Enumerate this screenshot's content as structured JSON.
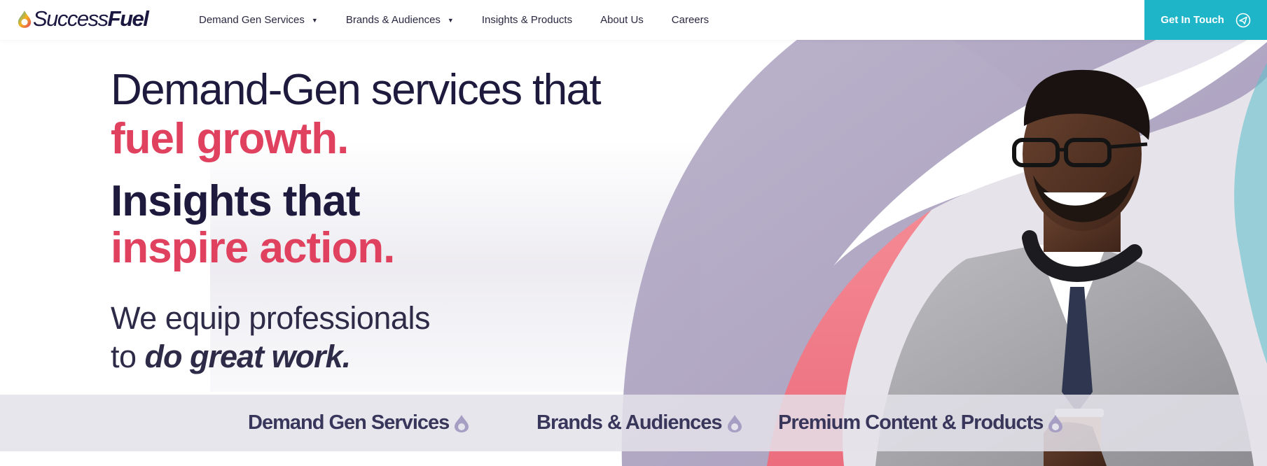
{
  "brand": {
    "name_part1": "Success",
    "name_part2": "Fuel"
  },
  "nav": {
    "items": [
      {
        "label": "Demand Gen Services",
        "has_dropdown": true
      },
      {
        "label": "Brands & Audiences",
        "has_dropdown": true
      },
      {
        "label": "Insights & Products",
        "has_dropdown": false
      },
      {
        "label": "About Us",
        "has_dropdown": false
      },
      {
        "label": "Careers",
        "has_dropdown": false
      }
    ],
    "cta_label": "Get In Touch",
    "cta_icon": "paper-plane-icon"
  },
  "hero": {
    "line1": "Demand-Gen services that",
    "line1_accent": "fuel growth.",
    "line2": "Insights that",
    "line2_accent": "inspire action.",
    "sub_line1": "We equip professionals",
    "sub_line2_prefix": "to ",
    "sub_line2_emphasis": "do great work",
    "sub_line2_suffix": "."
  },
  "bar": {
    "links": [
      {
        "label": "Demand Gen Services",
        "icon": "fuel-drop-icon"
      },
      {
        "label": "Brands & Audiences",
        "icon": "fuel-drop-icon"
      },
      {
        "label": "Premium Content & Products",
        "icon": "fuel-drop-icon"
      }
    ]
  },
  "colors": {
    "navy": "#1d1a3d",
    "accent_pink": "#e0415f",
    "cta_teal": "#1fb5c8",
    "lavender": "#a59bbb",
    "coral": "#f0788a"
  }
}
